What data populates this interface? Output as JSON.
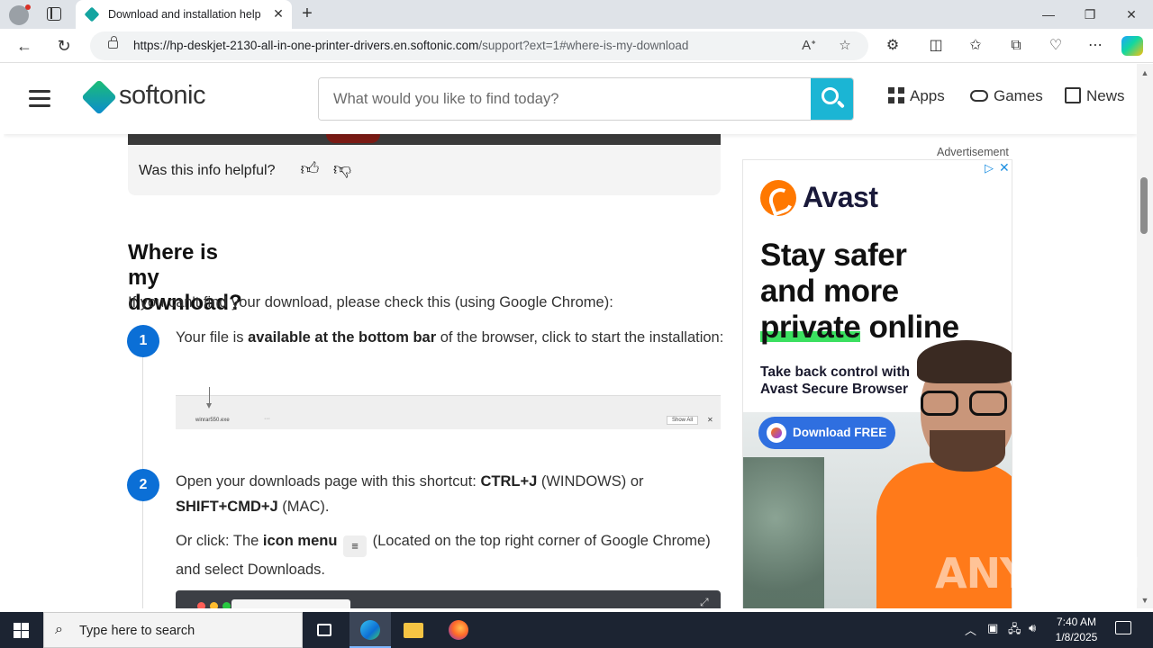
{
  "browser": {
    "tab_title": "Download and installation help",
    "url_host": "https://hp-deskjet-2130-all-in-one-printer-drivers.en.softonic.com",
    "url_path": "/support?ext=1#where-is-my-download"
  },
  "site": {
    "logo_text": "softonic",
    "search_placeholder": "What would you like to find today?",
    "nav": {
      "apps": "Apps",
      "games": "Games",
      "news": "News"
    }
  },
  "article": {
    "helpful_question": "Was this info helpful?",
    "section_title": "Where is my download?",
    "intro": "If you can't find your download, please check this (using Google Chrome):",
    "step1": {
      "number": "1",
      "text_a": "Your file is ",
      "text_bold": "available at the bottom bar",
      "text_b": " of the browser, click to start the installation:"
    },
    "download_bar": {
      "file": "winrar550.exe",
      "show_all": "Show All",
      "close": "✕"
    },
    "step2": {
      "number": "2",
      "text_a": "Open your downloads page with this shortcut: ",
      "bold1": "CTRL+J",
      "text_b": " (WINDOWS) or ",
      "bold2": "SHIFT+CMD+J",
      "text_c": " (MAC).",
      "or_click": "Or click:  The ",
      "icon_menu": "icon menu",
      "text_d": " (Located on the top right corner of Google Chrome) and select Downloads."
    }
  },
  "ad": {
    "label": "Advertisement",
    "brand": "Avast",
    "headline_1": "Stay safer",
    "headline_2": "and more",
    "headline_3a": "private",
    "headline_3b": " online",
    "subline": "Take back control with Avast Secure Browser",
    "cta": "Download FREE"
  },
  "watermark": "ANY RUN",
  "taskbar": {
    "search_placeholder": "Type here to search",
    "time": "7:40 AM",
    "date": "1/8/2025"
  },
  "colors": {
    "accent": "#1bb5d4",
    "step_blue": "#0b6fd6",
    "avast_orange": "#ff7800",
    "cta_blue": "#2f6fe0"
  }
}
